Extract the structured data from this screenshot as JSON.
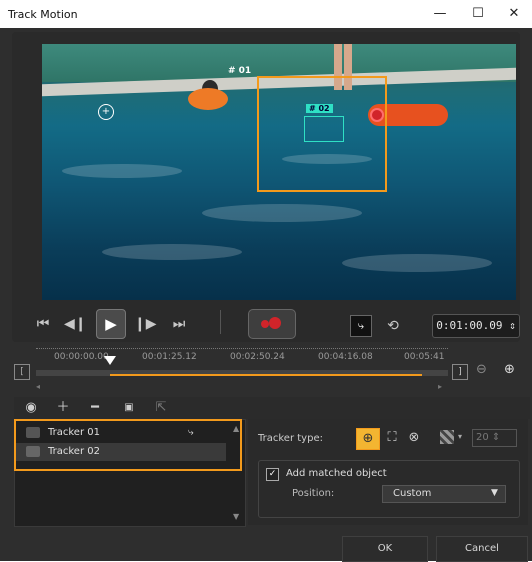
{
  "window": {
    "title": "Track Motion",
    "minimize_glyph": "—",
    "maximize_glyph": "☐",
    "close_glyph": "✕"
  },
  "video": {
    "tracker_labels": [
      "# 01",
      "# 02"
    ]
  },
  "transport": {
    "timecode": "0:01:00.09",
    "icons": [
      "skip-to-start-icon",
      "step-back-icon",
      "play-icon",
      "step-forward-icon",
      "skip-to-end-icon",
      "record-track-icon",
      "path-icon",
      "reset-history-icon"
    ]
  },
  "timeline": {
    "ticks": [
      "00:00:00.00",
      "00:01:25.12",
      "00:02:50.24",
      "00:04:16.08",
      "00:05:41"
    ],
    "playhead_fraction": 0.18
  },
  "tracker_toolbar": {
    "icons": [
      "eye-icon",
      "add-icon",
      "remove-icon",
      "rename-icon",
      "export-icon"
    ]
  },
  "trackers": [
    {
      "label": "Tracker 01",
      "selected": false
    },
    {
      "label": "Tracker 02",
      "selected": true
    }
  ],
  "properties": {
    "tracker_type_label": "Tracker type:",
    "add_matched_label": "Add matched object",
    "add_matched_checked": true,
    "position_label": "Position:",
    "position_value": "Custom",
    "size_value": "20"
  },
  "footer": {
    "ok_label": "OK",
    "cancel_label": "Cancel"
  },
  "colors": {
    "accent": "#f39a1c",
    "tracker_box": "#2fe0c5",
    "record_red": "#d1242a"
  }
}
